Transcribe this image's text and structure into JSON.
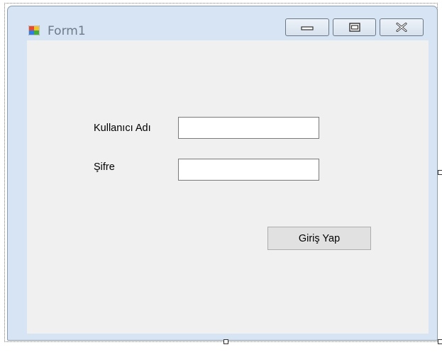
{
  "window": {
    "title": "Form1",
    "icon": "windows-form-icon",
    "caption_buttons": [
      "minimize-icon",
      "maximize-icon",
      "close-icon"
    ]
  },
  "form": {
    "username_label": "Kullanıcı Adı",
    "username_value": "",
    "password_label": "Şifre",
    "password_value": "",
    "login_button": "Giriş Yap"
  },
  "colors": {
    "client_background": "#f0f0f0",
    "window_frame": "#d6e4f3"
  }
}
